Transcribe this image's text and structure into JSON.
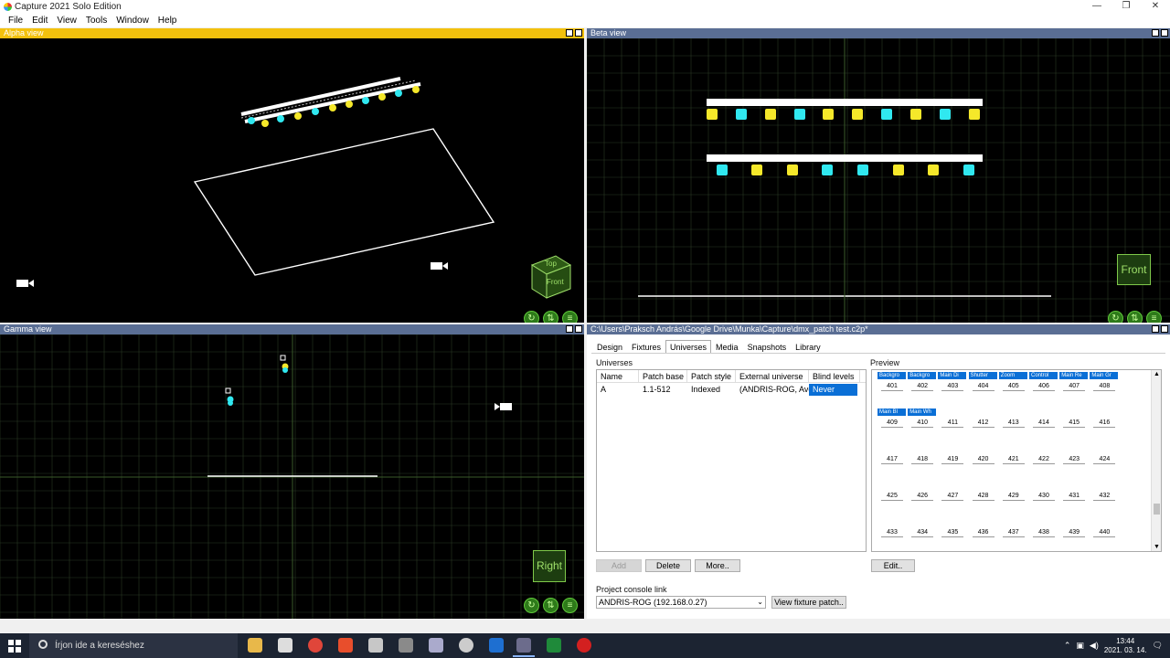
{
  "window": {
    "title": "Capture 2021 Solo Edition",
    "buttons": [
      "—",
      "❐",
      "✕"
    ]
  },
  "menu": [
    "File",
    "Edit",
    "View",
    "Tools",
    "Window",
    "Help"
  ],
  "views": {
    "alpha": {
      "title": "Alpha view"
    },
    "beta": {
      "title": "Beta view",
      "label": "Front"
    },
    "gamma": {
      "title": "Gamma view",
      "label": "Right"
    }
  },
  "nav_icons": [
    "↻",
    "⇅",
    "≡"
  ],
  "view_cube": {
    "top": "Top",
    "front": "Front"
  },
  "colors": {
    "active_header": "#f3c10d",
    "inactive_header": "#5a6e94",
    "grid": "#2a3a24",
    "selection": "#0a6fd6"
  },
  "config": {
    "path": "C:\\Users\\Praksch András\\Google Drive\\Munka\\Capture\\dmx_patch test.c2p*",
    "tabs": [
      "Design",
      "Fixtures",
      "Universes",
      "Media",
      "Snapshots",
      "Library"
    ],
    "active_tab": "Universes",
    "universes_label": "Universes",
    "preview_label": "Preview",
    "columns": [
      "Name",
      "Patch base",
      "Patch style",
      "External universe",
      "Blind levels"
    ],
    "rows": [
      {
        "name": "A",
        "patch_base": "1.1-512",
        "patch_style": "Indexed",
        "external": "(ANDRIS-ROG, Avoli...",
        "blind": "Never"
      }
    ],
    "buttons": {
      "add": "Add",
      "delete": "Delete",
      "more": "More..",
      "edit": "Edit.."
    },
    "console_label": "Project console link",
    "console_value": "ANDRIS-ROG (192.168.0.27)",
    "view_patch": "View fixture patch..",
    "preview_tags_row1": [
      "Backgro",
      "Backgro",
      "Main Di",
      "Shutter",
      "Zoom",
      "Control",
      "Main Re",
      "Main Gr"
    ],
    "preview_tags_row2": [
      "Main Bl",
      "Main Wh"
    ],
    "preview_numbers": [
      [
        "401",
        "402",
        "403",
        "404",
        "405",
        "406",
        "407",
        "408"
      ],
      [
        "409",
        "410",
        "411",
        "412",
        "413",
        "414",
        "415",
        "416"
      ],
      [
        "417",
        "418",
        "419",
        "420",
        "421",
        "422",
        "423",
        "424"
      ],
      [
        "425",
        "426",
        "427",
        "428",
        "429",
        "430",
        "431",
        "432"
      ],
      [
        "433",
        "434",
        "435",
        "436",
        "437",
        "438",
        "439",
        "440"
      ]
    ]
  },
  "taskbar": {
    "search_placeholder": "Írjon ide a kereséshez",
    "time": "13:44",
    "date": "2021. 03. 14."
  }
}
